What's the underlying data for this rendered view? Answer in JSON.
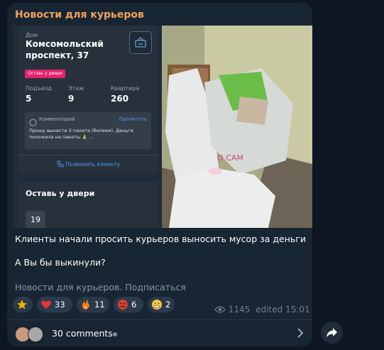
{
  "channel": {
    "name": "Новости для курьеров"
  },
  "order_card": {
    "house_label": "Дом",
    "address": "Комсомольский проспект, 37",
    "tag": "Оставь у двери",
    "entrance_label": "Подъезд",
    "entrance": "5",
    "floor_label": "Этаж",
    "floor": "9",
    "apartment_label": "Квартира",
    "apartment": "260",
    "comment_label": "Комментарий",
    "read_label": "Прочитать",
    "comment_text": "Прошу вынести 2 пакета (болеем). Деньги положила на пакеты 🙏 ...",
    "call_label": "Позвонить клиенту"
  },
  "second_card": {
    "title": "Оставь у двери",
    "number": "19"
  },
  "message": {
    "line1": "Клиенты начали просить курьеров выносить мусор за деньги",
    "line2": "А Вы бы выкинули?",
    "signature": "Новости для курьеров. Подписаться"
  },
  "reactions": [
    {
      "icon": "star-icon",
      "count": "",
      "color": "#f5b400"
    },
    {
      "icon": "heart-icon",
      "count": "33",
      "color": "#e8333b"
    },
    {
      "icon": "fire-icon",
      "count": "11",
      "color": "#ff7a1a"
    },
    {
      "icon": "angry-face-icon",
      "count": "6",
      "color": "#d6422f"
    },
    {
      "icon": "grimace-face-icon",
      "count": "2",
      "color": "#f2c744"
    }
  ],
  "meta": {
    "views": "1145",
    "edited": "edited 15:01"
  },
  "comments": {
    "label": "30 comments"
  }
}
